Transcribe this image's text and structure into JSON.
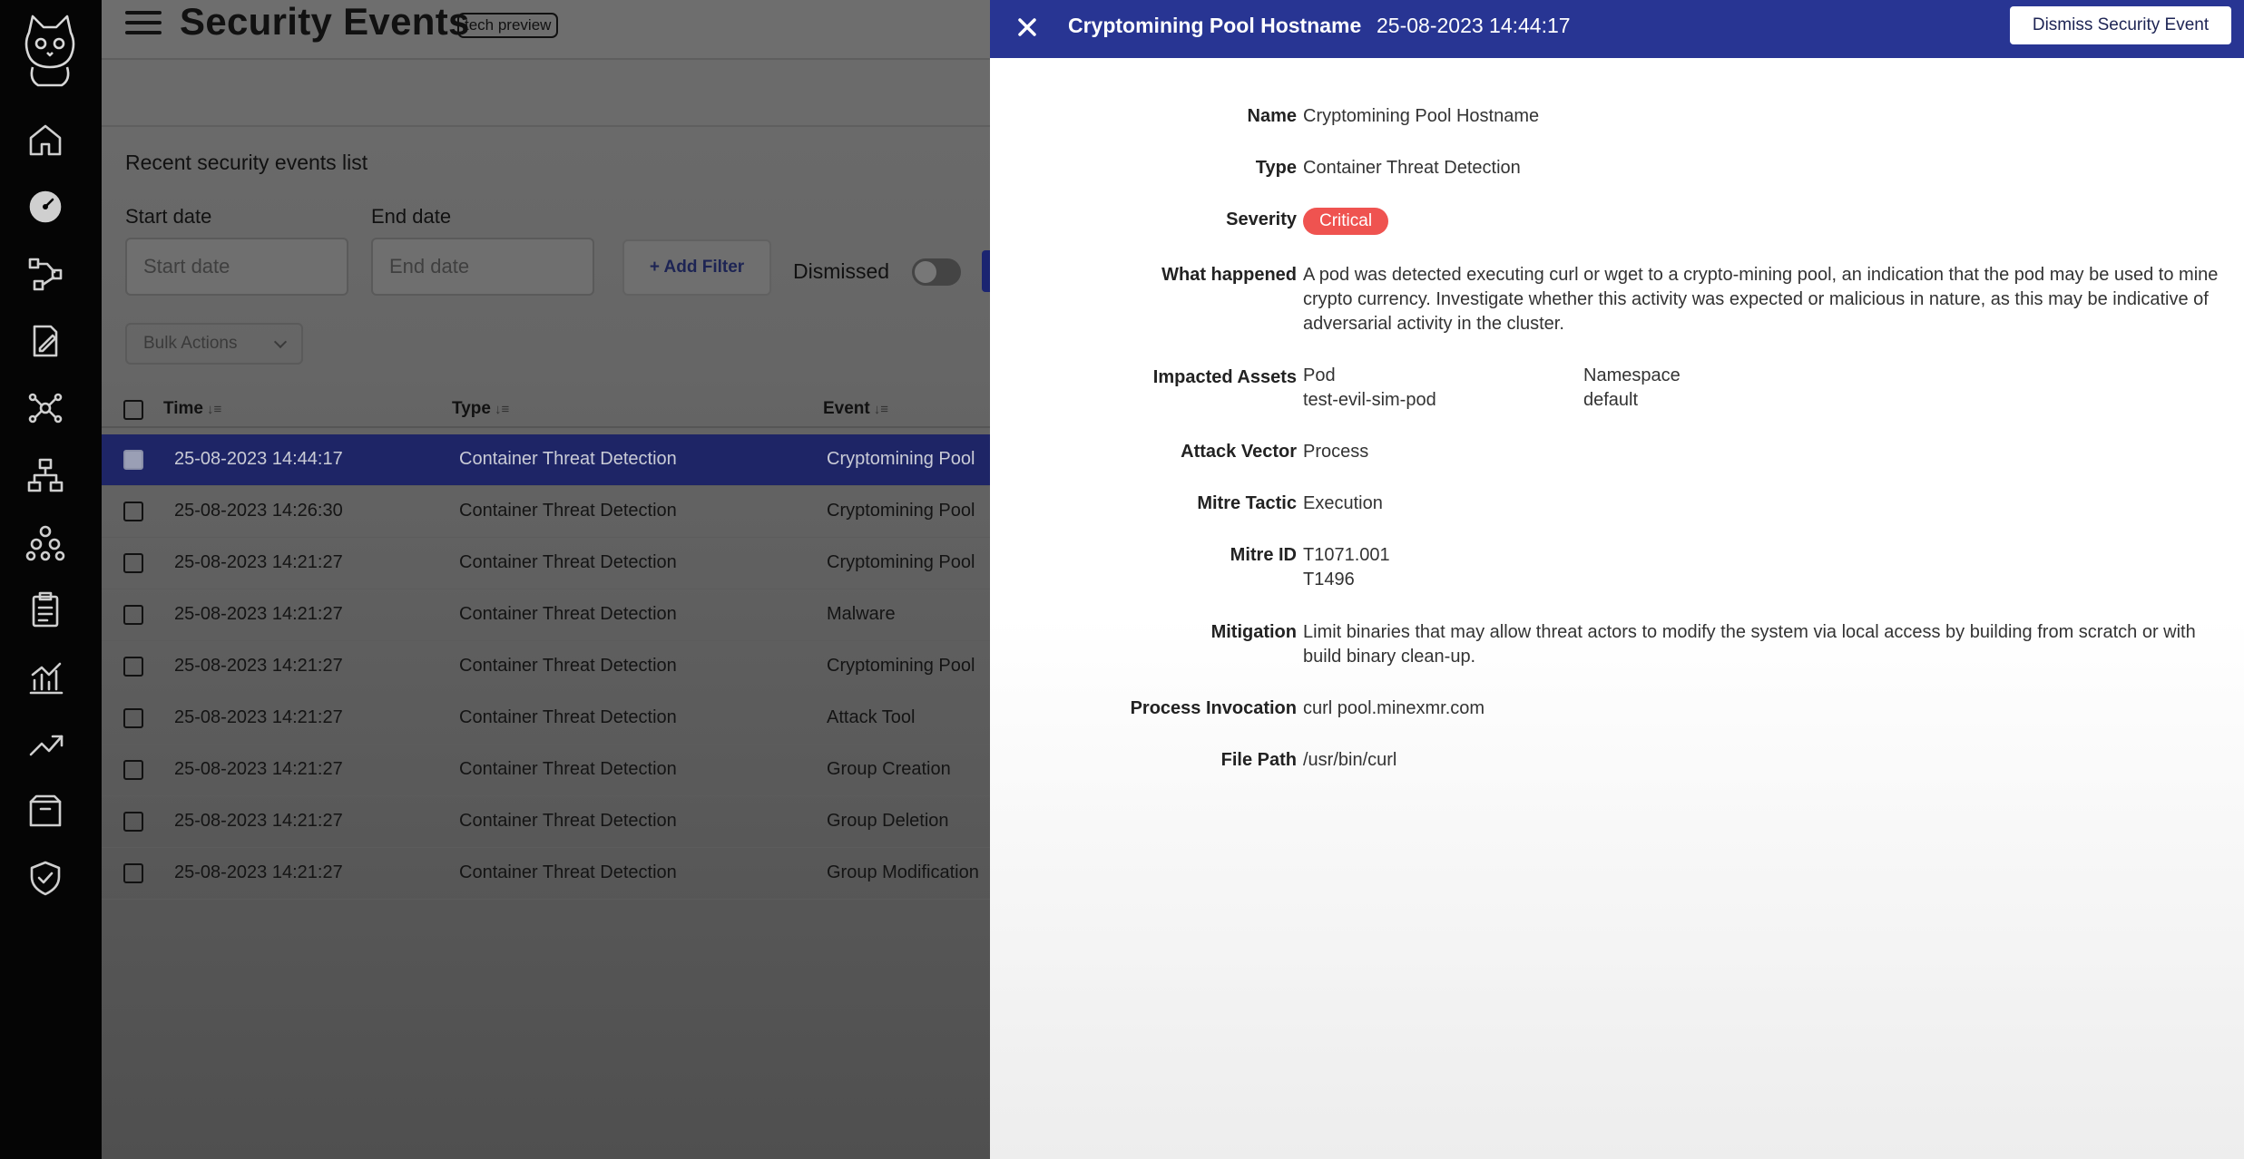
{
  "header": {
    "title": "Security Events",
    "badge": "tech preview"
  },
  "filters": {
    "list_heading": "Recent security events list",
    "start_label": "Start date",
    "start_placeholder": "Start date",
    "end_label": "End date",
    "end_placeholder": "End date",
    "add_filter": "+ Add Filter",
    "dismissed_label": "Dismissed",
    "bulk_actions": "Bulk Actions"
  },
  "table": {
    "columns": [
      "Time",
      "Type",
      "Event"
    ],
    "rows": [
      {
        "time": "25-08-2023 14:44:17",
        "type": "Container Threat Detection",
        "event": "Cryptomining Pool"
      },
      {
        "time": "25-08-2023 14:26:30",
        "type": "Container Threat Detection",
        "event": "Cryptomining Pool"
      },
      {
        "time": "25-08-2023 14:21:27",
        "type": "Container Threat Detection",
        "event": "Cryptomining Pool"
      },
      {
        "time": "25-08-2023 14:21:27",
        "type": "Container Threat Detection",
        "event": "Malware"
      },
      {
        "time": "25-08-2023 14:21:27",
        "type": "Container Threat Detection",
        "event": "Cryptomining Pool"
      },
      {
        "time": "25-08-2023 14:21:27",
        "type": "Container Threat Detection",
        "event": "Attack Tool"
      },
      {
        "time": "25-08-2023 14:21:27",
        "type": "Container Threat Detection",
        "event": "Group Creation"
      },
      {
        "time": "25-08-2023 14:21:27",
        "type": "Container Threat Detection",
        "event": "Group Deletion"
      },
      {
        "time": "25-08-2023 14:21:27",
        "type": "Container Threat Detection",
        "event": "Group Modification"
      }
    ]
  },
  "drawer": {
    "title": "Cryptomining Pool Hostname",
    "timestamp": "25-08-2023 14:44:17",
    "dismiss_button": "Dismiss Security Event",
    "labels": {
      "name": "Name",
      "type": "Type",
      "severity": "Severity",
      "what_happened": "What happened",
      "impacted_assets": "Impacted Assets",
      "attack_vector": "Attack Vector",
      "mitre_tactic": "Mitre Tactic",
      "mitre_id": "Mitre ID",
      "mitigation": "Mitigation",
      "process_invocation": "Process Invocation",
      "file_path": "File Path"
    },
    "values": {
      "name": "Cryptomining Pool Hostname",
      "type": "Container Threat Detection",
      "severity": "Critical",
      "what_happened": "A pod was detected executing curl or wget to a crypto-mining pool, an indication that the pod may be used to mine crypto currency. Investigate whether this activity was expected or malicious in nature, as this may be indicative of adversarial activity in the cluster.",
      "assets": {
        "pod_label": "Pod",
        "pod_value": "test-evil-sim-pod",
        "namespace_label": "Namespace",
        "namespace_value": "default"
      },
      "attack_vector": "Process",
      "mitre_tactic": "Execution",
      "mitre_ids": [
        "T1071.001",
        "T1496"
      ],
      "mitigation": "Limit binaries that may allow threat actors to modify the system via local access by building from scratch or with build binary clean-up.",
      "process_invocation": "curl pool.minexmr.com",
      "file_path": "/usr/bin/curl"
    }
  },
  "colors": {
    "drawer_header": "#283593",
    "selected_row": "#1e2566",
    "critical": "#ef5350"
  }
}
